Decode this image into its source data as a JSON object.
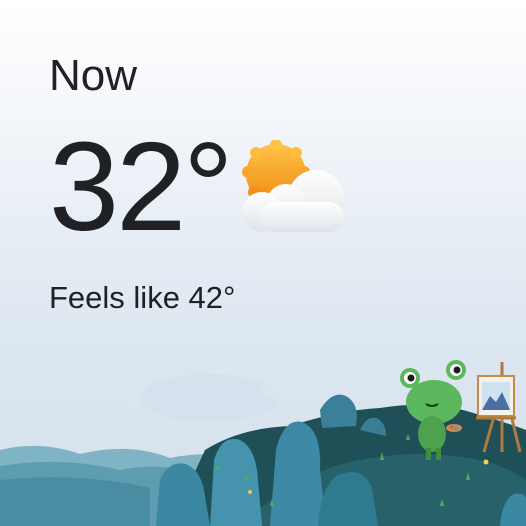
{
  "current": {
    "label": "Now",
    "temperature": "32°",
    "feels_like": "Feels like 42°",
    "condition_icon": "partly-cloudy-icon"
  },
  "scene": {
    "illustration": "frog-painting-on-hill",
    "colors": {
      "sky_top": "#ffffff",
      "sky_bottom": "#d4e0ec",
      "sun": "#f5a623",
      "cloud": "#f4f6f8",
      "hill_dark": "#1d4a52",
      "hill_mid": "#2d6b6e",
      "rock": "#3f8fa8",
      "frog": "#5cb85c"
    }
  }
}
